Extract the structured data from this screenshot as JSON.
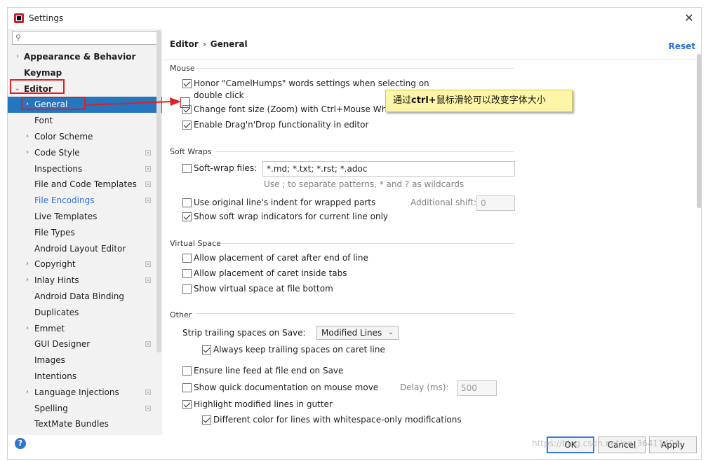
{
  "window": {
    "title": "Settings",
    "close_label": "✕"
  },
  "sidebar": {
    "search_placeholder": "",
    "items": [
      {
        "label": "Appearance & Behavior",
        "arrow": "›"
      },
      {
        "label": "Keymap",
        "arrow": ""
      },
      {
        "label": "Editor",
        "arrow": "⌄"
      },
      {
        "label": "General",
        "arrow": "›"
      },
      {
        "label": "Font",
        "arrow": ""
      },
      {
        "label": "Color Scheme",
        "arrow": "›"
      },
      {
        "label": "Code Style",
        "arrow": "›"
      },
      {
        "label": "Inspections",
        "arrow": ""
      },
      {
        "label": "File and Code Templates",
        "arrow": ""
      },
      {
        "label": "File Encodings",
        "arrow": ""
      },
      {
        "label": "Live Templates",
        "arrow": ""
      },
      {
        "label": "File Types",
        "arrow": ""
      },
      {
        "label": "Android Layout Editor",
        "arrow": ""
      },
      {
        "label": "Copyright",
        "arrow": "›"
      },
      {
        "label": "Inlay Hints",
        "arrow": "›"
      },
      {
        "label": "Android Data Binding",
        "arrow": ""
      },
      {
        "label": "Duplicates",
        "arrow": ""
      },
      {
        "label": "Emmet",
        "arrow": "›"
      },
      {
        "label": "GUI Designer",
        "arrow": ""
      },
      {
        "label": "Images",
        "arrow": ""
      },
      {
        "label": "Intentions",
        "arrow": ""
      },
      {
        "label": "Language Injections",
        "arrow": "›"
      },
      {
        "label": "Spelling",
        "arrow": ""
      },
      {
        "label": "TextMate Bundles",
        "arrow": ""
      }
    ],
    "help_label": "?"
  },
  "header": {
    "crumb1": "Editor",
    "sep": "›",
    "crumb2": "General",
    "reset": "Reset"
  },
  "sections": {
    "mouse": {
      "title": "Mouse",
      "camel_line1": "Honor \"CamelHumps\" words settings when selecting on",
      "camel_line2": "double click",
      "zoom": "Change font size (Zoom) with Ctrl+Mouse Wheel",
      "dnd": "Enable Drag'n'Drop functionality in editor"
    },
    "soft_wraps": {
      "title": "Soft Wraps",
      "files_label": "Soft-wrap files:",
      "files_value": "*.md; *.txt; *.rst; *.adoc",
      "hint": "Use ; to separate patterns, * and ? as wildcards",
      "indent": "Use original line's indent for wrapped parts",
      "shift_label": "Additional shift:",
      "shift_value": "0",
      "indicators": "Show soft wrap indicators for current line only"
    },
    "virtual_space": {
      "title": "Virtual Space",
      "after_end": "Allow placement of caret after end of line",
      "inside_tabs": "Allow placement of caret inside tabs",
      "file_bottom": "Show virtual space at file bottom"
    },
    "other": {
      "title": "Other",
      "strip_label": "Strip trailing spaces on Save:",
      "strip_value": "Modified Lines",
      "keep_trailing": "Always keep trailing spaces on caret line",
      "line_feed": "Ensure line feed at file end on Save",
      "quick_doc": "Show quick documentation on mouse move",
      "delay_label": "Delay (ms):",
      "delay_value": "500",
      "highlight_modified": "Highlight modified lines in gutter",
      "whitespace_color": "Different color for lines with whitespace-only modifications"
    }
  },
  "callout": {
    "prefix": "通过",
    "bold": "ctrl+",
    "suffix": "鼠标滑轮可以改变字体大小"
  },
  "buttons": {
    "ok": "OK",
    "cancel": "Cancel",
    "apply": "Apply"
  },
  "watermark": "https://blog.csdn.net/qq_36411404",
  "colors": {
    "selection": "#2675bf",
    "annotation_red": "#e02020",
    "link_blue": "#2e6fd6",
    "callout_bg": "#fdf6a8"
  }
}
